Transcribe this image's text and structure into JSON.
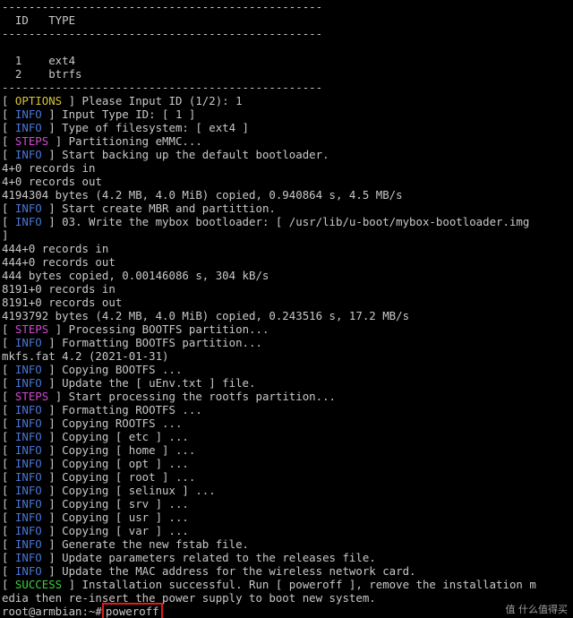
{
  "terminal": {
    "sep": "------------------------------------------------",
    "header": "  ID   TYPE",
    "table_rows": [
      "  1    ext4",
      "  2    btrfs"
    ],
    "tags": {
      "options": "OPTIONS",
      "info": "INFO",
      "steps": "STEPS",
      "success": "SUCCESS"
    },
    "lines": [
      {
        "tag": "options",
        "text": " Please Input ID (1/2): 1"
      },
      {
        "tag": "info",
        "text": " Input Type ID: [ 1 ]"
      },
      {
        "tag": "info",
        "text": " Type of filesystem: [ ext4 ]"
      },
      {
        "tag": "steps",
        "text": " Partitioning eMMC..."
      },
      {
        "tag": "info",
        "text": " Start backing up the default bootloader."
      },
      {
        "plain": "4+0 records in"
      },
      {
        "plain": "4+0 records out"
      },
      {
        "plain": "4194304 bytes (4.2 MB, 4.0 MiB) copied, 0.940864 s, 4.5 MB/s"
      },
      {
        "tag": "info",
        "text": " Start create MBR and partittion."
      },
      {
        "tag": "info",
        "text": " 03. Write the mybox bootloader: [ /usr/lib/u-boot/mybox-bootloader.img"
      },
      {
        "plain": "]"
      },
      {
        "plain": "444+0 records in"
      },
      {
        "plain": "444+0 records out"
      },
      {
        "plain": "444 bytes copied, 0.00146086 s, 304 kB/s"
      },
      {
        "plain": "8191+0 records in"
      },
      {
        "plain": "8191+0 records out"
      },
      {
        "plain": "4193792 bytes (4.2 MB, 4.0 MiB) copied, 0.243516 s, 17.2 MB/s"
      },
      {
        "tag": "steps",
        "text": " Processing BOOTFS partition..."
      },
      {
        "tag": "info",
        "text": " Formatting BOOTFS partition..."
      },
      {
        "plain": "mkfs.fat 4.2 (2021-01-31)"
      },
      {
        "tag": "info",
        "text": " Copying BOOTFS ..."
      },
      {
        "tag": "info",
        "text": " Update the [ uEnv.txt ] file."
      },
      {
        "tag": "steps",
        "text": " Start processing the rootfs partition..."
      },
      {
        "tag": "info",
        "text": " Formatting ROOTFS ..."
      },
      {
        "tag": "info",
        "text": " Copying ROOTFS ..."
      },
      {
        "tag": "info",
        "text": " Copying [ etc ] ..."
      },
      {
        "tag": "info",
        "text": " Copying [ home ] ..."
      },
      {
        "tag": "info",
        "text": " Copying [ opt ] ..."
      },
      {
        "tag": "info",
        "text": " Copying [ root ] ..."
      },
      {
        "tag": "info",
        "text": " Copying [ selinux ] ..."
      },
      {
        "tag": "info",
        "text": " Copying [ srv ] ..."
      },
      {
        "tag": "info",
        "text": " Copying [ usr ] ..."
      },
      {
        "tag": "info",
        "text": " Copying [ var ] ..."
      },
      {
        "tag": "info",
        "text": " Generate the new fstab file."
      },
      {
        "tag": "info",
        "text": " Update parameters related to the releases file."
      },
      {
        "tag": "info",
        "text": " Update the MAC address for the wireless network card."
      },
      {
        "tag": "success",
        "text": " Installation successful. Run [ poweroff ], remove the installation m"
      },
      {
        "plain": "edia then re-insert the power supply to boot new system."
      }
    ],
    "prompt": "root@armbian:~#",
    "command": "poweroff",
    "watermark": "值 什么值得买"
  }
}
